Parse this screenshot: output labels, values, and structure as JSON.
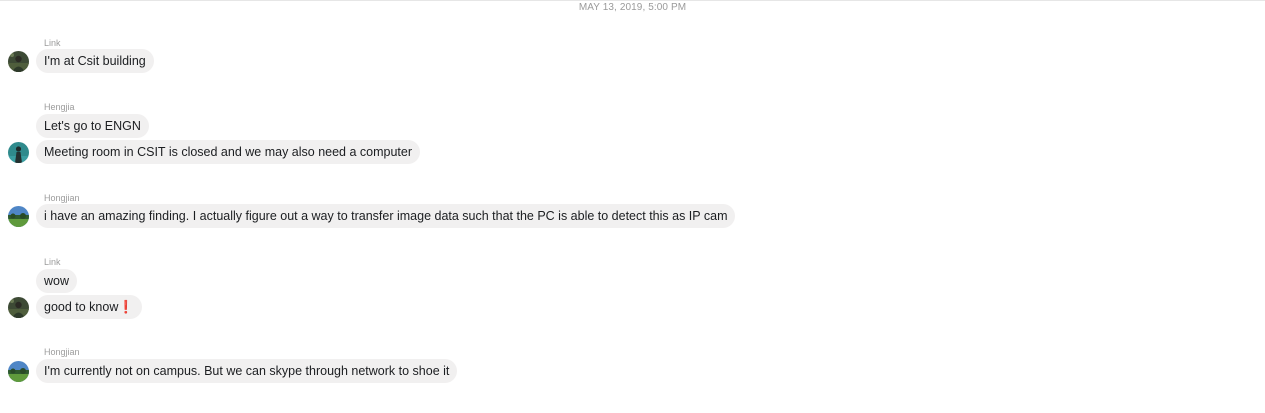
{
  "timestamp": "MAY 13, 2019, 5:00 PM",
  "groups": [
    {
      "sender": "Link",
      "avatar_icon": "person-avatar-icon",
      "messages": [
        "I'm at Csit building"
      ]
    },
    {
      "sender": "Hengjia",
      "avatar_icon": "person-avatar-icon",
      "messages": [
        "Let's go to ENGN",
        "Meeting room in CSIT is closed and we may also need a computer"
      ]
    },
    {
      "sender": "Hongjian",
      "avatar_icon": "landscape-avatar-icon",
      "messages": [
        "i have an amazing finding. I actually figure out a way to transfer image data such that the PC is able to detect this as IP cam"
      ]
    },
    {
      "sender": "Link",
      "avatar_icon": "person-avatar-icon",
      "messages": [
        "wow",
        "good to know❗"
      ]
    },
    {
      "sender": "Hongjian",
      "avatar_icon": "landscape-avatar-icon",
      "messages": [
        "I'm currently not on campus. But we can skype through network to shoe it"
      ]
    }
  ],
  "colors": {
    "bubble_bg": "#f1f0f0",
    "text": "#1c1e21",
    "meta": "#9c9c9c"
  }
}
